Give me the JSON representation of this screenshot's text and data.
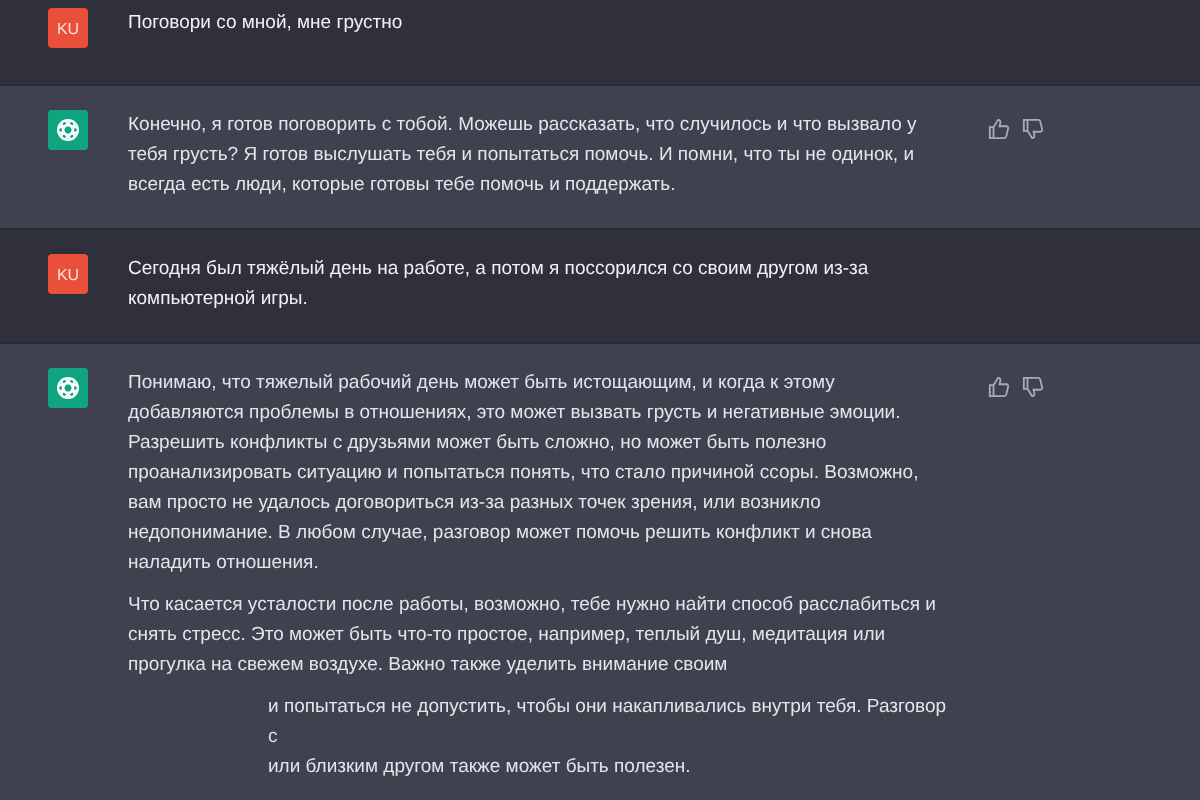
{
  "messages": [
    {
      "kind": "user",
      "avatar": "KU",
      "paragraphs": [
        "Поговори со мной, мне грустно"
      ]
    },
    {
      "kind": "assistant",
      "paragraphs": [
        "Конечно, я готов поговорить с тобой. Можешь рассказать, что случилось и что вызвало у тебя грусть? Я готов выслушать тебя и попытаться помочь. И помни, что ты не одинок, и всегда есть люди, которые готовы тебе помочь и поддержать."
      ]
    },
    {
      "kind": "user",
      "avatar": "KU",
      "paragraphs": [
        "Сегодня был тяжёлый день на работе, а потом я поссорился со своим другом из-за компьютерной игры."
      ]
    },
    {
      "kind": "assistant",
      "paragraphs": [
        "Понимаю, что тяжелый рабочий день может быть истощающим, и когда к этому добавляются проблемы в отношениях, это может вызвать грусть и негативные эмоции. Разрешить конфликты с друзьями может быть сложно, но может быть полезно проанализировать ситуацию и попытаться понять, что стало причиной ссоры. Возможно, вам просто не удалось договориться из-за разных точек зрения, или возникло недопонимание. В любом случае, разговор может помочь решить конфликт и снова наладить отношения.",
        "Что касается усталости после работы, возможно, тебе нужно найти способ расслабиться и снять стресс. Это может быть что-то простое, например, теплый душ, медитация или прогулка на свежем воздухе. Важно также уделить внимание своим"
      ],
      "cut_lines": [
        "и попытаться не допустить, чтобы они накапливались внутри тебя. Разговор с",
        "или близким другом также может быть полезен."
      ]
    }
  ]
}
